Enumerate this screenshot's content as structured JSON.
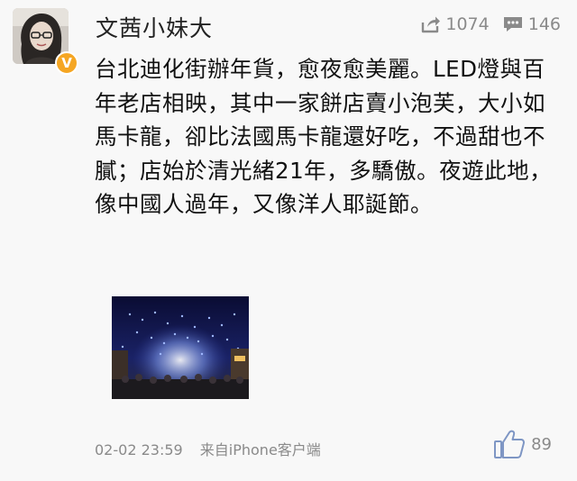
{
  "post": {
    "author": "文茜小妹大",
    "verified_badge": "V",
    "repost_count": "1074",
    "comment_count": "146",
    "text": "台北迪化街辦年貨，愈夜愈美麗。LED燈與百年老店相映，其中一家餅店賣小泡芙，大小如馬卡龍，卻比法國馬卡龍還好吃，不過甜也不膩；店始於清光緒21年，多驕傲。夜遊此地，像中國人過年，又像洋人耶誕節。",
    "timestamp": "02-02 23:59",
    "source": "来自iPhone客户端",
    "like_count": "89"
  },
  "icons": {
    "repost": "repost-icon",
    "comment": "comment-icon",
    "like": "thumbs-up-icon",
    "verified": "verified-badge-icon"
  },
  "colors": {
    "background": "#f8f8f8",
    "meta_gray": "#8a8a8a",
    "badge_orange": "#f5a623",
    "text": "#111111"
  }
}
